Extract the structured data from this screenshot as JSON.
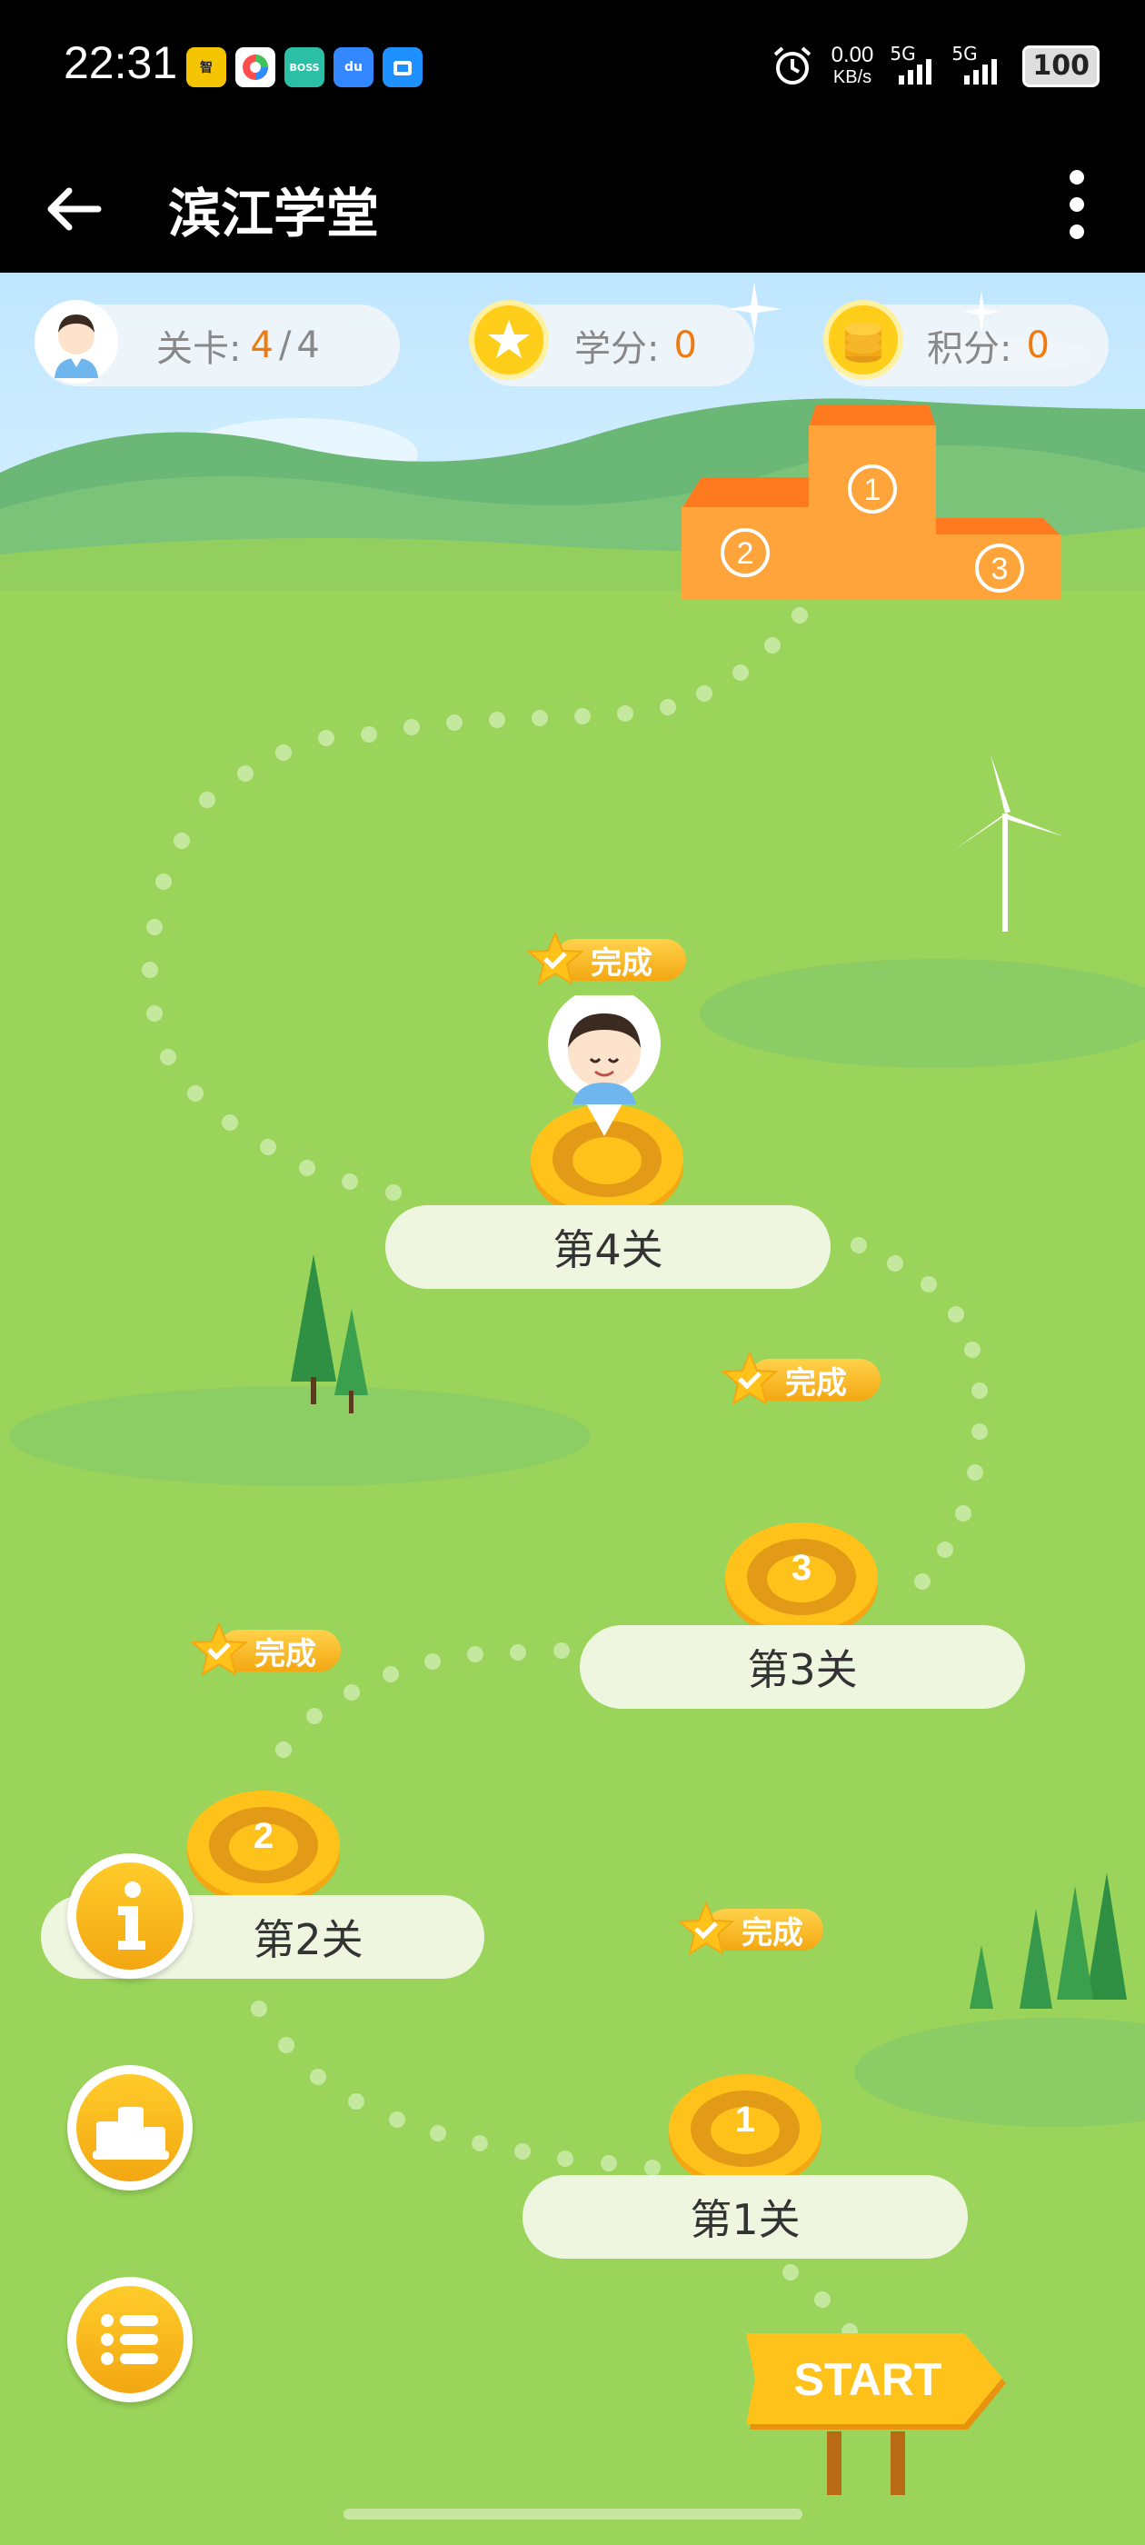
{
  "status_bar": {
    "time": "22:31",
    "net_speed_value": "0.00",
    "net_speed_unit": "KB/s",
    "sig1_label": "5G",
    "sig2_label": "5G",
    "battery": "100",
    "app_icons": [
      {
        "name": "app-icon-1",
        "color": "#f5c400",
        "text": "智"
      },
      {
        "name": "app-icon-2",
        "color": "#ffffff",
        "text": ""
      },
      {
        "name": "app-icon-boss",
        "color": "#2bc0a5",
        "text": "BOSS"
      },
      {
        "name": "app-icon-baidu",
        "color": "#3388ff",
        "text": "du"
      },
      {
        "name": "app-icon-5",
        "color": "#1e90ff",
        "text": ""
      }
    ]
  },
  "app_bar": {
    "title": "滨江学堂"
  },
  "header": {
    "level_label": "关卡:",
    "level_current": "4",
    "level_sep": "/",
    "level_total": "4",
    "credits_label": "学分:",
    "credits_value": "0",
    "points_label": "积分:",
    "points_value": "0"
  },
  "podium": {
    "first": "1",
    "second": "2",
    "third": "3"
  },
  "levels": [
    {
      "label": "第1关",
      "coin": "1",
      "badge": "完成"
    },
    {
      "label": "第2关",
      "coin": "2",
      "badge": "完成"
    },
    {
      "label": "第3关",
      "coin": "3",
      "badge": "完成"
    },
    {
      "label": "第4关",
      "coin": "",
      "badge": "完成"
    }
  ],
  "start_sign": "START",
  "colors": {
    "accent_orange": "#f07a10",
    "coin_gold": "#f3a712",
    "grass": "#9ad45a"
  },
  "side_buttons": [
    {
      "icon": "info-icon"
    },
    {
      "icon": "ranking-podium-icon"
    },
    {
      "icon": "list-icon"
    }
  ]
}
